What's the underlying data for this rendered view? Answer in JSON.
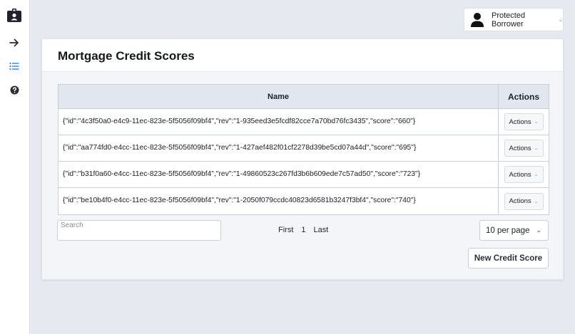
{
  "user": {
    "name": "Protected Borrower"
  },
  "page": {
    "title": "Mortgage Credit Scores"
  },
  "table": {
    "columns": {
      "name": "Name",
      "actions": "Actions"
    },
    "rows": [
      {
        "name": "{\"id\":\"4c3f50a0-e4c9-11ec-823e-5f5056f09bf4\",\"rev\":\"1-935eed3e5fcdf82cce7a70bd76fc3435\",\"score\":\"660\"}",
        "action": "Actions"
      },
      {
        "name": "{\"id\":\"aa774fd0-e4cc-11ec-823e-5f5056f09bf4\",\"rev\":\"1-427aef482f01cf2278d39be5cd07a44d\",\"score\":\"695\"}",
        "action": "Actions"
      },
      {
        "name": "{\"id\":\"b31f0a60-e4cc-11ec-823e-5f5056f09bf4\",\"rev\":\"1-49860523c267fd3b6b609ede7c57ad50\",\"score\":\"723\"}",
        "action": "Actions"
      },
      {
        "name": "{\"id\":\"be10b4f0-e4cc-11ec-823e-5f5056f09bf4\",\"rev\":\"1-2050f079ccdc40823d6581b3247f3bf4\",\"score\":\"740\"}",
        "action": "Actions"
      }
    ]
  },
  "search": {
    "placeholder": "Search"
  },
  "pager": {
    "first": "First",
    "current": "1",
    "last": "Last"
  },
  "perpage": {
    "selected": "10 per page"
  },
  "new_button": "New Credit Score",
  "icons": {
    "sidebar": [
      "id-badge-icon",
      "arrow-right-icon",
      "list-icon",
      "help-icon"
    ],
    "accent": "#2f80ed"
  }
}
